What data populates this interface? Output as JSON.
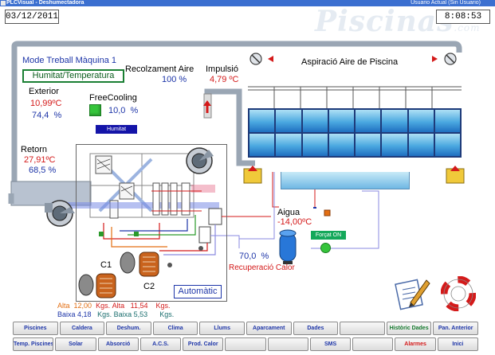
{
  "window": {
    "title": "PLCVisual - Deshumectadora",
    "user": "Usuario Actual  (Sin Usuario)"
  },
  "header": {
    "date": "03/12/2011",
    "time": "8:08:53"
  },
  "watermark": {
    "text": "Piscinas",
    "suffix": ".com"
  },
  "mode": {
    "title": "Mode Treball Màquina 1",
    "selector": "Humitat/Temperatura",
    "status_button": "Automàtic"
  },
  "readings": {
    "exterior": {
      "label": "Exterior",
      "temp": "10,99ºC",
      "hum": "74,4",
      "hum_unit": "%"
    },
    "recolzament": {
      "label": "Recolzament Aire",
      "value": "100",
      "unit": "%"
    },
    "impulsio": {
      "label": "Impulsió",
      "temp": "4,79 ºC"
    },
    "freecooling": {
      "label": "FreeCooling",
      "value": "10,0",
      "unit": "%",
      "tag": "Humitat"
    },
    "retorn": {
      "label": "Retorn",
      "temp": "27,91ºC",
      "hum": "68,5",
      "hum_unit": "%"
    },
    "aigua": {
      "label": "Aigua",
      "temp": "-14,00ºC",
      "tag": "Forçat ON"
    },
    "recuperacio": {
      "value": "70,0",
      "unit": "%",
      "label": "Recuperació Calor"
    },
    "pool_label": "Aspiració Aire de Piscina"
  },
  "compressors": {
    "c1": "C1",
    "c2": "C2",
    "alta_label": "Alta",
    "baixa_label": "Baixa",
    "unit": "Kgs.",
    "c1_alta": "12,00",
    "c1_baixa": "4,18",
    "c2_alta": "11,54",
    "c2_baixa": "5,53"
  },
  "nav_row1": [
    {
      "label": "Piscines",
      "style": ""
    },
    {
      "label": "Caldera",
      "style": ""
    },
    {
      "label": "Deshum.",
      "style": ""
    },
    {
      "label": "Clima",
      "style": ""
    },
    {
      "label": "Llums",
      "style": ""
    },
    {
      "label": "Aparcament",
      "style": ""
    },
    {
      "label": "Dades",
      "style": ""
    },
    {
      "label": "",
      "style": "empty"
    },
    {
      "label": "Històric Dades",
      "style": "green"
    },
    {
      "label": "Pan. Anterior",
      "style": ""
    }
  ],
  "nav_row2": [
    {
      "label": "Temp. Piscines",
      "style": ""
    },
    {
      "label": "Solar",
      "style": ""
    },
    {
      "label": "Absorció",
      "style": ""
    },
    {
      "label": "A.C.S.",
      "style": ""
    },
    {
      "label": "Prod. Calor",
      "style": ""
    },
    {
      "label": "",
      "style": "empty"
    },
    {
      "label": "",
      "style": "empty"
    },
    {
      "label": "SMS",
      "style": ""
    },
    {
      "label": "",
      "style": "empty"
    },
    {
      "label": "Alarmes",
      "style": "red"
    },
    {
      "label": "Inici",
      "style": ""
    }
  ],
  "colors": {
    "accent_blue": "#1d35a8",
    "value_red": "#d41a1a",
    "duct_gray": "#9aa6b4",
    "ok_green": "#35c43b"
  }
}
